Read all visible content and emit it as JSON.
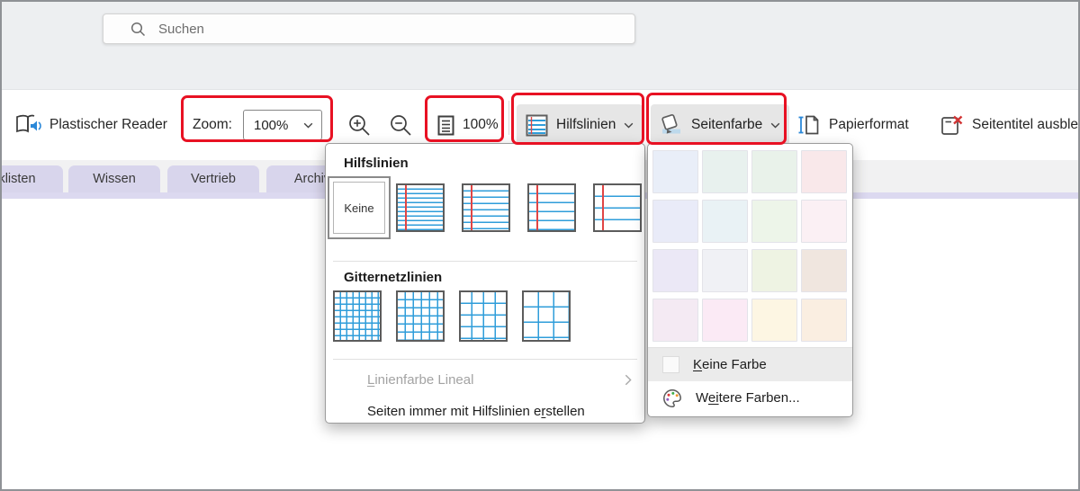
{
  "search": {
    "placeholder": "Suchen"
  },
  "ribbon": {
    "immersive_reader_label": "Plastischer Reader",
    "zoom_label": "Zoom:",
    "zoom_value": "100%",
    "fit_value": "100%",
    "guides_label": "Hilfslinien",
    "page_color_label": "Seitenfarbe",
    "paper_format_label": "Papierformat",
    "hide_title_label": "Seitentitel ausblen"
  },
  "tabs": [
    {
      "label": "klisten"
    },
    {
      "label": "Wissen"
    },
    {
      "label": "Vertrieb"
    },
    {
      "label": "Archiv"
    }
  ],
  "guides_menu": {
    "section_lines_title": "Hilfslinien",
    "none_tile_label": "Keine",
    "ruled_tiles": [
      {
        "name": "ruled-narrow",
        "spacing": 5
      },
      {
        "name": "ruled-college",
        "spacing": 7
      },
      {
        "name": "ruled-standard",
        "spacing": 10
      },
      {
        "name": "ruled-wide",
        "spacing": 13
      }
    ],
    "section_grid_title": "Gitternetzlinien",
    "grid_tiles": [
      {
        "name": "grid-small",
        "spacing": 7
      },
      {
        "name": "grid-medium",
        "spacing": 9
      },
      {
        "name": "grid-large",
        "spacing": 13
      },
      {
        "name": "grid-xlarge",
        "spacing": 17
      }
    ],
    "line_color_accel": "L",
    "line_color_rest": "inienfarbe Lineal",
    "always_create_pre": "Seiten immer mit Hilfslinien e",
    "always_create_accel": "r",
    "always_create_rest": "stellen"
  },
  "color_menu": {
    "swatches": [
      "#e9eef8",
      "#e8f1ee",
      "#e9f2ea",
      "#f9e8ea",
      "#e9ebf8",
      "#e9f2f5",
      "#edf5e9",
      "#fbf0f4",
      "#ebe8f6",
      "#f0f1f5",
      "#eef3e3",
      "#f0e6df",
      "#f4eaf3",
      "#fbeaf5",
      "#fdf6e3",
      "#faeee1"
    ],
    "no_color_accel": "K",
    "no_color_rest": "eine Farbe",
    "more_colors_pre": "W",
    "more_colors_accel": "ei",
    "more_colors_rest": "tere Farben..."
  },
  "colors": {
    "annotation_red": "#e8112d",
    "guide_line_blue": "#2f9dda",
    "guide_margin_red": "#e04545",
    "tab_lavender": "#d8d5ec",
    "strip_lavender": "#dcd9f0",
    "topbar_gray": "#edeff1"
  }
}
